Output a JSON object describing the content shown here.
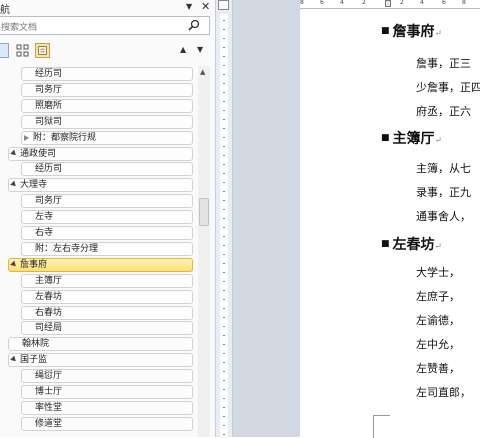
{
  "nav": {
    "title": "航",
    "search_placeholder": "搜索文档",
    "tree": [
      {
        "label": "经历司",
        "indent": 1,
        "expander": "none",
        "selected": false
      },
      {
        "label": "司务厅",
        "indent": 1,
        "expander": "none",
        "selected": false
      },
      {
        "label": "照磨所",
        "indent": 1,
        "expander": "none",
        "selected": false
      },
      {
        "label": "司狱司",
        "indent": 1,
        "expander": "none",
        "selected": false
      },
      {
        "label": "附：都察院行规",
        "indent": 1,
        "expander": "closed",
        "selected": false
      },
      {
        "label": "通政使司",
        "indent": 0,
        "expander": "open",
        "selected": false
      },
      {
        "label": "经历司",
        "indent": 1,
        "expander": "none",
        "selected": false
      },
      {
        "label": "大理寺",
        "indent": 0,
        "expander": "open",
        "selected": false
      },
      {
        "label": "司务厅",
        "indent": 1,
        "expander": "none",
        "selected": false
      },
      {
        "label": "左寺",
        "indent": 1,
        "expander": "none",
        "selected": false
      },
      {
        "label": "右寺",
        "indent": 1,
        "expander": "none",
        "selected": false
      },
      {
        "label": "附：左右寺分理",
        "indent": 1,
        "expander": "none",
        "selected": false
      },
      {
        "label": "詹事府",
        "indent": 0,
        "expander": "open",
        "selected": true
      },
      {
        "label": "主簿厅",
        "indent": 1,
        "expander": "none",
        "selected": false
      },
      {
        "label": "左春坊",
        "indent": 1,
        "expander": "none",
        "selected": false
      },
      {
        "label": "右春坊",
        "indent": 1,
        "expander": "none",
        "selected": false
      },
      {
        "label": "司经局",
        "indent": 1,
        "expander": "none",
        "selected": false
      },
      {
        "label": "翰林院",
        "indent": 0,
        "expander": "none",
        "selected": false
      },
      {
        "label": "国子监",
        "indent": 0,
        "expander": "open",
        "selected": false
      },
      {
        "label": "绳愆厅",
        "indent": 1,
        "expander": "none",
        "selected": false
      },
      {
        "label": "博士厅",
        "indent": 1,
        "expander": "none",
        "selected": false
      },
      {
        "label": "率性堂",
        "indent": 1,
        "expander": "none",
        "selected": false
      },
      {
        "label": "修道堂",
        "indent": 1,
        "expander": "none",
        "selected": false
      }
    ]
  },
  "ruler": {
    "numbers": [
      "8",
      "6",
      "4",
      "2",
      "2",
      "4",
      "6",
      "8"
    ]
  },
  "document": {
    "heading1": "詹事府",
    "lines1": [
      "詹事，正三",
      "少詹事，正四",
      "府丞，正六"
    ],
    "heading2": "主簿厅",
    "lines2": [
      "主簿，从七",
      "录事，正九",
      "通事舍人，"
    ],
    "heading3": "左春坊",
    "lines3": [
      "大学士，",
      "左庶子，",
      "左谕德，",
      "左中允，",
      "左赞善，",
      "左司直郎，"
    ],
    "paragraph_mark": "↵"
  }
}
